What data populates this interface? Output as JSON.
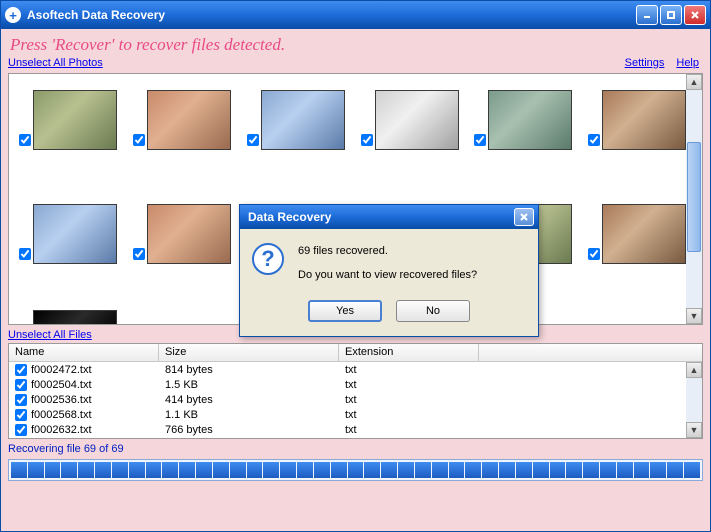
{
  "titlebar": {
    "title": "Asoftech Data Recovery"
  },
  "instruction": "Press 'Recover' to recover files detected.",
  "links": {
    "unselect_photos": "Unselect All Photos",
    "settings": "Settings",
    "help": "Help",
    "unselect_files": "Unselect All Files"
  },
  "thumbs": [
    {
      "checked": true,
      "ph": "ph-a"
    },
    {
      "checked": true,
      "ph": "ph-b"
    },
    {
      "checked": true,
      "ph": "ph-c"
    },
    {
      "checked": true,
      "ph": "ph-d"
    },
    {
      "checked": true,
      "ph": "ph-e"
    },
    {
      "checked": true,
      "ph": "ph-f"
    },
    {
      "checked": true,
      "ph": "ph-c"
    },
    {
      "checked": true,
      "ph": "ph-b"
    },
    {
      "checked": false,
      "ph": "",
      "empty": true
    },
    {
      "checked": true,
      "ph": "ph-e"
    },
    {
      "checked": true,
      "ph": "ph-a"
    },
    {
      "checked": true,
      "ph": "ph-f"
    },
    {
      "checked": false,
      "ph": "ph-dark",
      "partial": true
    }
  ],
  "files": {
    "columns": {
      "name": "Name",
      "size": "Size",
      "ext": "Extension"
    },
    "rows": [
      {
        "name": "f0002472.txt",
        "size": "814 bytes",
        "ext": "txt",
        "checked": true
      },
      {
        "name": "f0002504.txt",
        "size": "1.5 KB",
        "ext": "txt",
        "checked": true
      },
      {
        "name": "f0002536.txt",
        "size": "414 bytes",
        "ext": "txt",
        "checked": true
      },
      {
        "name": "f0002568.txt",
        "size": "1.1 KB",
        "ext": "txt",
        "checked": true
      },
      {
        "name": "f0002632.txt",
        "size": "766 bytes",
        "ext": "txt",
        "checked": true
      }
    ]
  },
  "status": "Recovering file 69 of 69",
  "progress": {
    "segments": 41
  },
  "dialog": {
    "title": "Data Recovery",
    "line1": "69 files recovered.",
    "line2": "Do you want to view recovered files?",
    "yes": "Yes",
    "no": "No"
  }
}
